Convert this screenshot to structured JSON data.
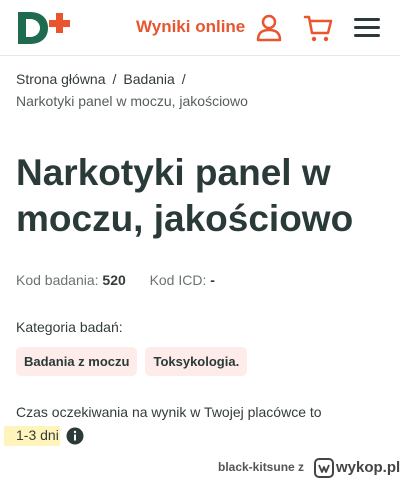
{
  "header": {
    "logo_label": "D+",
    "results_link": "Wyniki online",
    "icons": [
      "user-icon",
      "cart-icon",
      "menu-icon"
    ],
    "brand_colors": {
      "green": "#1f6b4f",
      "orange": "#e8552e"
    }
  },
  "breadcrumb": {
    "items": [
      "Strona główna",
      "Badania"
    ],
    "separator": "/",
    "current": "Narkotyki panel w moczu, jakościowo"
  },
  "page": {
    "title": "Narkotyki panel w moczu, jakościowo",
    "code_label": "Kod badania:",
    "code_value": "520",
    "icd_label": "Kod ICD:",
    "icd_value": "-",
    "category_label": "Kategoria badań:",
    "categories": [
      "Badania z moczu",
      "Toksykologia."
    ],
    "wait_text": "Czas oczekiwania na wynik w Twojej placówce to",
    "wait_value": "1-3 dni"
  },
  "watermark": {
    "user": "black-kitsune",
    "connector": "z",
    "site": "wykop.pl"
  }
}
